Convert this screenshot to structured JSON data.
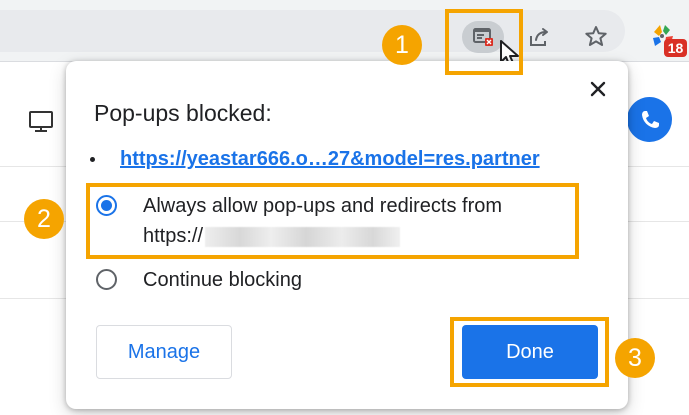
{
  "browser": {
    "extension_badge": "18"
  },
  "popup": {
    "title": "Pop-ups blocked:",
    "blocked_link": "https://yeastar666.o…27&model=res.partner",
    "options": {
      "allow_line_1": "Always allow pop-ups and redirects from",
      "allow_line_2_prefix": "https://",
      "continue_blocking": "Continue blocking"
    },
    "buttons": {
      "manage": "Manage",
      "done": "Done"
    }
  },
  "annotations": {
    "step_1": "1",
    "step_2": "2",
    "step_3": "3"
  },
  "colors": {
    "accent": "#1a73e8",
    "annotation": "#f5a400",
    "badge": "#d93025"
  },
  "icons": {
    "popup_blocked": "popup-blocked-icon",
    "share": "share-icon",
    "star": "star-icon",
    "extension": "extension-icon",
    "close": "close-icon",
    "monitor": "monitor-icon",
    "phone": "phone-icon",
    "cursor": "cursor-icon"
  }
}
